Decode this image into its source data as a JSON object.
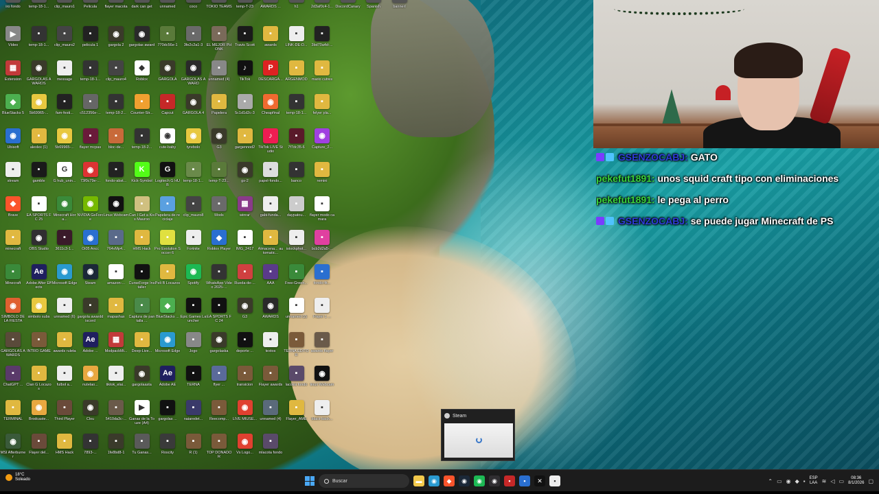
{
  "desktop": {
    "icons": [
      {
        "label": "Vídeo",
        "color": "#888888",
        "glyph": "▶"
      },
      {
        "label": "temp-18-1...",
        "color": "#333333",
        "glyph": "▪"
      },
      {
        "label": "clip_mauro2",
        "color": "#444444",
        "glyph": "▪"
      },
      {
        "label": "pelicula 1",
        "color": "#222222",
        "glyph": "▪"
      },
      {
        "label": "gargola 2",
        "color": "#3a3a2a",
        "glyph": "◉"
      },
      {
        "label": "gargolas award",
        "color": "#2a2a2a",
        "glyph": "◉"
      },
      {
        "label": "770dc56e-1",
        "color": "#5a7a3a",
        "glyph": "▪"
      },
      {
        "label": "3fe2c2a1-3",
        "color": "#6a6a6a",
        "glyph": "▪"
      },
      {
        "label": "EL MEJOR PHONK",
        "color": "#7a6a5a",
        "glyph": "▪"
      },
      {
        "label": "Travis Scott",
        "color": "#1a1a1a",
        "glyph": "▪"
      },
      {
        "label": "awards",
        "color": "#e0b840",
        "glyph": "▪"
      },
      {
        "label": "LINK-DE-D...",
        "color": "#eeeeee",
        "glyph": "▪"
      },
      {
        "label": "3bd70a4d-...",
        "color": "#222222",
        "glyph": "▪"
      },
      {
        "label": "Extension",
        "color": "#c23a3a",
        "glyph": "▦"
      },
      {
        "label": "GARGOLAS AWARDS",
        "color": "#3a3a2a",
        "glyph": "◉"
      },
      {
        "label": "message",
        "color": "#eeeeee",
        "glyph": "▪"
      },
      {
        "label": "temp-18-1...",
        "color": "#333333",
        "glyph": "▪"
      },
      {
        "label": "clip_mauro4",
        "color": "#444444",
        "glyph": "▪"
      },
      {
        "label": "Roblox",
        "color": "#ffffff",
        "glyph": "◆"
      },
      {
        "label": "GARGOLA",
        "color": "#3a3a2a",
        "glyph": "◉"
      },
      {
        "label": "GARGOLAS AWARD",
        "color": "#2a2a2a",
        "glyph": "◉"
      },
      {
        "label": "unnamed (4)",
        "color": "#888888",
        "glyph": "▪"
      },
      {
        "label": "TikTok",
        "color": "#111111",
        "glyph": "♪"
      },
      {
        "label": "DESCARGA...",
        "color": "#d22",
        "glyph": "P"
      },
      {
        "label": "ARGENMOD",
        "color": "#e0b840",
        "glyph": "▪"
      },
      {
        "label": "mario cutres",
        "color": "#e0b840",
        "glyph": "▪"
      },
      {
        "label": "BlueStacks 5",
        "color": "#4caf50",
        "glyph": "◆"
      },
      {
        "label": "5b69965-...",
        "color": "#e8c840",
        "glyph": "◉"
      },
      {
        "label": "fam-festi...",
        "color": "#222222",
        "glyph": "▪"
      },
      {
        "label": "c512356e-...",
        "color": "#666666",
        "glyph": "▪"
      },
      {
        "label": "temp-18-2...",
        "color": "#333333",
        "glyph": "▪"
      },
      {
        "label": "Counter-Str...",
        "color": "#f0a030",
        "glyph": "▪"
      },
      {
        "label": "Capcut",
        "color": "#c62828",
        "glyph": "▪"
      },
      {
        "label": "GARGOLA 4",
        "color": "#3a3a2a",
        "glyph": "◉"
      },
      {
        "label": "Papelera",
        "color": "#e0b840",
        "glyph": "▪"
      },
      {
        "label": "5c1d1d2c-3",
        "color": "#aaaaaa",
        "glyph": "▪"
      },
      {
        "label": "Cheapfinal",
        "color": "#f06a30",
        "glyph": "◉"
      },
      {
        "label": "temp-18-1...",
        "color": "#333333",
        "glyph": "▪"
      },
      {
        "label": "felyer pla...",
        "color": "#e0b840",
        "glyph": "▪"
      },
      {
        "label": "Ubisoft",
        "color": "#2a6fd0",
        "glyph": "◉"
      },
      {
        "label": "alexlex (1)",
        "color": "#e0b840",
        "glyph": "▪"
      },
      {
        "label": "5b69965-...",
        "color": "#e8c840",
        "glyph": "◉"
      },
      {
        "label": "flayer mcpas",
        "color": "#6a1a3a",
        "glyph": "▪"
      },
      {
        "label": "bloc-de...",
        "color": "#c86a3a",
        "glyph": "▪"
      },
      {
        "label": "temp-18-2...",
        "color": "#333333",
        "glyph": "▪"
      },
      {
        "label": "cute-baby",
        "color": "#ffffff",
        "glyph": "◉"
      },
      {
        "label": "tyrebolo",
        "color": "#e8c840",
        "glyph": "◉"
      },
      {
        "label": "G3",
        "color": "#3a3a2a",
        "glyph": "◉"
      },
      {
        "label": "gargennod2",
        "color": "#e0b840",
        "glyph": "▪"
      },
      {
        "label": "TikTok LIVE Studio",
        "color": "#ee1d52",
        "glyph": "♪"
      },
      {
        "label": "7f7dc35-6",
        "color": "#5a1a2a",
        "glyph": "▪"
      },
      {
        "label": "Capture_2...",
        "color": "#a040e0",
        "glyph": "◉"
      },
      {
        "label": "stream",
        "color": "#eeeeee",
        "glyph": "▪"
      },
      {
        "label": "gamble",
        "color": "#1a1a1a",
        "glyph": "▪"
      },
      {
        "label": "G hub_unin...",
        "color": "#ffffff",
        "glyph": "G"
      },
      {
        "label": "73f0c79e-...",
        "color": "#d33",
        "glyph": "◉"
      },
      {
        "label": "fondo-abst...",
        "color": "#222222",
        "glyph": "▪"
      },
      {
        "label": "Kick-Symbol",
        "color": "#53fc18",
        "glyph": "K"
      },
      {
        "label": "Logitech G HUB",
        "color": "#111111",
        "glyph": "G"
      },
      {
        "label": "temp-18-1...",
        "color": "#6a8a4a",
        "glyph": "▪"
      },
      {
        "label": "temp-T-23...",
        "color": "#5a7a3a",
        "glyph": "▪"
      },
      {
        "label": "gs-2",
        "color": "#3a3a2a",
        "glyph": "◉"
      },
      {
        "label": "papel-fondo...",
        "color": "#dddddd",
        "glyph": "▪"
      },
      {
        "label": "banco",
        "color": "#333333",
        "glyph": "▪"
      },
      {
        "label": "remini",
        "color": "#e0b840",
        "glyph": "▪"
      },
      {
        "label": "Brave",
        "color": "#fb542b",
        "glyph": "◆"
      },
      {
        "label": "EA SPORTS FC 25",
        "color": "#ffffff",
        "glyph": "▪"
      },
      {
        "label": "Minecraft Hora...",
        "color": "#3a8a3a",
        "glyph": "◉"
      },
      {
        "label": "NVIDIA GeForce",
        "color": "#76b900",
        "glyph": "◉"
      },
      {
        "label": "Linux Webcam",
        "color": "#111111",
        "glyph": "◉"
      },
      {
        "label": "Can I Get a Kiss Mauroo",
        "color": "#d0c080",
        "glyph": "▪"
      },
      {
        "label": "Papelera de reciclaje",
        "color": "#5aa0e0",
        "glyph": "▪"
      },
      {
        "label": "clip_mauro8",
        "color": "#444444",
        "glyph": "▪"
      },
      {
        "label": "Mods",
        "color": "#6a6a6a",
        "glyph": "▪"
      },
      {
        "label": "winrar",
        "color": "#8a3a8a",
        "glyph": "▦"
      },
      {
        "label": "gabi-funda...",
        "color": "#eeeeee",
        "glyph": "▪"
      },
      {
        "label": "daypatou...",
        "color": "#cccccc",
        "glyph": "▪"
      },
      {
        "label": "flayer modo camara",
        "color": "#ffffff",
        "glyph": "▪"
      },
      {
        "label": "minecraft",
        "color": "#e0b840",
        "glyph": "▪"
      },
      {
        "label": "OBS Studio",
        "color": "#302e31",
        "glyph": "◉"
      },
      {
        "label": "3611c3-1...",
        "color": "#3a1a2a",
        "glyph": "▪"
      },
      {
        "label": "Oi05 Ancc",
        "color": "#2a6fd0",
        "glyph": "◉"
      },
      {
        "label": "764vMp4...",
        "color": "#5a6a8a",
        "glyph": "▪"
      },
      {
        "label": "HMS Hack",
        "color": "#e0b840",
        "glyph": "▪"
      },
      {
        "label": "Pro Evolution Soccer 6",
        "color": "#e0e040",
        "glyph": "▪"
      },
      {
        "label": "Fortnite",
        "color": "#eeeeee",
        "glyph": "▪"
      },
      {
        "label": "Roblox Player",
        "color": "#2a6fd0",
        "glyph": "◆"
      },
      {
        "label": "IMG_2417",
        "color": "#ffffff",
        "glyph": "▪"
      },
      {
        "label": "Almacena... automatic...",
        "color": "#e0b840",
        "glyph": "▪"
      },
      {
        "label": "istockphot...",
        "color": "#eeeeee",
        "glyph": "▪"
      },
      {
        "label": "bcb2d2a5-...",
        "color": "#e040a0",
        "glyph": "▪"
      },
      {
        "label": "Minecraft",
        "color": "#3a8a3a",
        "glyph": "▪"
      },
      {
        "label": "Adobe After Effects",
        "color": "#1f1f5f",
        "glyph": "Ae"
      },
      {
        "label": "Microsoft Edge",
        "color": "#2a9ad0",
        "glyph": "◉"
      },
      {
        "label": "Steam",
        "color": "#1b2838",
        "glyph": "◉"
      },
      {
        "label": "amazon-...",
        "color": "#ffffff",
        "glyph": "▪"
      },
      {
        "label": "CurseForge Installer",
        "color": "#111111",
        "glyph": "▪"
      },
      {
        "label": "Peli B Locazos",
        "color": "#e0b840",
        "glyph": "▪"
      },
      {
        "label": "Spotify",
        "color": "#1db954",
        "glyph": "◉"
      },
      {
        "label": "WhatsApp Video 2025-...",
        "color": "#333333",
        "glyph": "▪"
      },
      {
        "label": "Rueda-de-...",
        "color": "#d04040",
        "glyph": "▪"
      },
      {
        "label": "AAA",
        "color": "#5a3a8a",
        "glyph": "▪"
      },
      {
        "label": "Free-Green...",
        "color": "#3a8a3a",
        "glyph": "▪"
      },
      {
        "label": "fondo-fit...",
        "color": "#2a6fd0",
        "glyph": "▪"
      },
      {
        "label": "SIMBOLO DE LA FIESTA",
        "color": "#e06030",
        "glyph": "◉"
      },
      {
        "label": "simbolo subs",
        "color": "#e8c840",
        "glyph": "◉"
      },
      {
        "label": "unnamed (6)",
        "color": "#eeeeee",
        "glyph": "▪"
      },
      {
        "label": "gargola awarddiscord",
        "color": "#3a3a2a",
        "glyph": "▪"
      },
      {
        "label": "mapashax",
        "color": "#e0b840",
        "glyph": "▪"
      },
      {
        "label": "Captura de pantalla ...",
        "color": "#4a8a4a",
        "glyph": "▪"
      },
      {
        "label": "BlueStacks ...",
        "color": "#4caf50",
        "glyph": "◆"
      },
      {
        "label": "Epic Games Launcher",
        "color": "#111111",
        "glyph": "▪"
      },
      {
        "label": "EA SPORTS FC 24",
        "color": "#111111",
        "glyph": "▪"
      },
      {
        "label": "G3",
        "color": "#3a3a2a",
        "glyph": "◉"
      },
      {
        "label": "AWARDS",
        "color": "#2a2a2a",
        "glyph": "◉"
      },
      {
        "label": "unnamed (2)",
        "color": "#ffffff",
        "glyph": "▪"
      },
      {
        "label": "Flayer 1 ...",
        "color": "#eeeeee",
        "glyph": "▪"
      },
      {
        "label": "GARGOLAS AWARDS",
        "color": "#5a4a3a",
        "glyph": "▪"
      },
      {
        "label": "INTRO GAME",
        "color": "#7a5a3a",
        "glyph": "▪"
      },
      {
        "label": "awards ruleta",
        "color": "#e0b840",
        "glyph": "▪"
      },
      {
        "label": "Adobe ...",
        "color": "#1f1f5f",
        "glyph": "Ae"
      },
      {
        "label": "ModpackMi...",
        "color": "#c23a3a",
        "glyph": "▦"
      },
      {
        "label": "Deep-Live...",
        "color": "#e0b840",
        "glyph": "▪"
      },
      {
        "label": "Microsoft Edge",
        "color": "#2a9ad0",
        "glyph": "◉"
      },
      {
        "label": "Jogo",
        "color": "#888888",
        "glyph": "▪"
      },
      {
        "label": "gargolaska",
        "color": "#3a3a2a",
        "glyph": "◉"
      },
      {
        "label": "deporte ...",
        "color": "#111111",
        "glyph": "▪"
      },
      {
        "label": "textos",
        "color": "#eeeeee",
        "glyph": "▪"
      },
      {
        "label": "TERNA EDITOR",
        "color": "#7a5a3a",
        "glyph": "▪"
      },
      {
        "label": "awards flayer",
        "color": "#6a5a4a",
        "glyph": "▪"
      },
      {
        "label": "ChatGPT ...",
        "color": "#5a3a6a",
        "glyph": "▪"
      },
      {
        "label": "Clan G Locazos",
        "color": "#e0b840",
        "glyph": "▪"
      },
      {
        "label": "futbol a...",
        "color": "#eeeeee",
        "glyph": "▪"
      },
      {
        "label": "nutelao...",
        "color": "#e8a840",
        "glyph": "◉"
      },
      {
        "label": "tiktok_elai...",
        "color": "#eeeeee",
        "glyph": "▪"
      },
      {
        "label": "gargolaasta",
        "color": "#3a3a2a",
        "glyph": "◉"
      },
      {
        "label": "Adobe AE",
        "color": "#1f1f5f",
        "glyph": "Ae"
      },
      {
        "label": "TERNA",
        "color": "#111111",
        "glyph": "▪"
      },
      {
        "label": "flyer ...",
        "color": "#5a6a9a",
        "glyph": "▪"
      },
      {
        "label": "transicion",
        "color": "#7a5a3a",
        "glyph": "▪"
      },
      {
        "label": "Flayer awards",
        "color": "#7a5a3a",
        "glyph": "▪"
      },
      {
        "label": "lacotra fondo",
        "color": "#5a4a6a",
        "glyph": "▪"
      },
      {
        "label": "linux Webcam",
        "color": "#111111",
        "glyph": "◉"
      },
      {
        "label": "TERMINAL",
        "color": "#e0b840",
        "glyph": "▪"
      },
      {
        "label": "Brodcaste...",
        "color": "#e8a840",
        "glyph": "◉"
      },
      {
        "label": "Third Player",
        "color": "#6a4a3a",
        "glyph": "▪"
      },
      {
        "label": "Clou",
        "color": "#3a3a2a",
        "glyph": "◉"
      },
      {
        "label": "5410da3c-...",
        "color": "#6a5a4a",
        "glyph": "▪"
      },
      {
        "label": "Ganas de la Touze (A4)",
        "color": "#ffffff",
        "glyph": "▶"
      },
      {
        "label": "gargolas ...",
        "color": "#111111",
        "glyph": "▪"
      },
      {
        "label": "naiaredet...",
        "color": "#3a3a6a",
        "glyph": "▪"
      },
      {
        "label": "Reecomp...",
        "color": "#7a5a3a",
        "glyph": "▪"
      },
      {
        "label": "LIVE MIUSE...",
        "color": "#e04030",
        "glyph": "◉"
      },
      {
        "label": "unnamed (4)",
        "color": "#5a6a7a",
        "glyph": "▪"
      },
      {
        "label": "Flayer_AME",
        "color": "#e0b840",
        "glyph": "▪"
      },
      {
        "label": "black-back...",
        "color": "#eeeeee",
        "glyph": "▪"
      },
      {
        "label": "MSI Afterburner",
        "color": "#3a5a3a",
        "glyph": "◉"
      },
      {
        "label": "Flayer del...",
        "color": "#6a4a3a",
        "glyph": "▪"
      },
      {
        "label": "HMS Hack",
        "color": "#e0b840",
        "glyph": "▪"
      },
      {
        "label": "7893-...",
        "color": "#333333",
        "glyph": "▪"
      },
      {
        "label": "1fe8bd8-1",
        "color": "#3a3a2a",
        "glyph": "▪"
      },
      {
        "label": "Tu Ganas...",
        "color": "#5a5a5a",
        "glyph": "▪"
      },
      {
        "label": "Roscity",
        "color": "#3a3a3a",
        "glyph": "▪"
      },
      {
        "label": "R (1)",
        "color": "#7a5a3a",
        "glyph": "▪"
      },
      {
        "label": "TOP DONADOR",
        "color": "#7a5a3a",
        "glyph": "▪"
      },
      {
        "label": "Vs Logo...",
        "color": "#e04030",
        "glyph": "◉"
      },
      {
        "label": "mlacota fondo",
        "color": "#5a4a6a",
        "glyph": "▪"
      }
    ],
    "top_row_labels": [
      "iro fondo",
      "temp-18-1...",
      "clip_mauro1",
      "Pelicula",
      "flayer macota",
      "dark can get",
      "unnamed",
      "coco",
      "TOKIO TEAMS",
      "temp-T-23",
      "AWARDS ...",
      "h1",
      "2d3af0c4-1...",
      "DiscordCanary",
      "Spanish",
      "bannerl"
    ]
  },
  "webcam": {
    "description_alt": ""
  },
  "chat": {
    "messages": [
      {
        "user": "GSENZOCABJ:",
        "text": "GATO",
        "user_color": "#2f3bd9",
        "badges": true
      },
      {
        "user": "pekefut1891:",
        "text": "unos squid craft tipo con eliminaciones",
        "user_color": "#3ad33a",
        "badges": false
      },
      {
        "user": "pekefut1891:",
        "text": "le pega al perro",
        "user_color": "#3ad33a",
        "badges": false
      },
      {
        "user": "GSENZOCABJ:",
        "text": "se puede jugar Minecraft de PS",
        "user_color": "#2f3bd9",
        "badges": true
      }
    ]
  },
  "steam_popup": {
    "title": "Steam"
  },
  "taskbar": {
    "weather_temp": "18°C",
    "weather_desc": "Soleado",
    "search_placeholder": "Buscar",
    "language_line1": "ESP",
    "language_line2": "LAA",
    "time": "08:36",
    "date": "8/1/2026",
    "pinned": [
      {
        "name": "file-explorer-icon",
        "color": "#f2c94c",
        "glyph": "▬"
      },
      {
        "name": "edge-icon",
        "color": "#2a9ad0",
        "glyph": "◉"
      },
      {
        "name": "brave-icon",
        "color": "#fb542b",
        "glyph": "◆"
      },
      {
        "name": "steam-icon",
        "color": "#1b2838",
        "glyph": "◉"
      },
      {
        "name": "spotify-icon",
        "color": "#1db954",
        "glyph": "◉"
      },
      {
        "name": "obs-icon",
        "color": "#302e31",
        "glyph": "◉"
      },
      {
        "name": "recording-icon",
        "color": "#c62828",
        "glyph": "▪"
      },
      {
        "name": "app-icon",
        "color": "#2a6fd0",
        "glyph": "▪"
      },
      {
        "name": "capcut-icon",
        "color": "#111111",
        "glyph": "✕"
      },
      {
        "name": "notes-icon",
        "color": "#eeeeee",
        "glyph": "▪"
      }
    ]
  }
}
